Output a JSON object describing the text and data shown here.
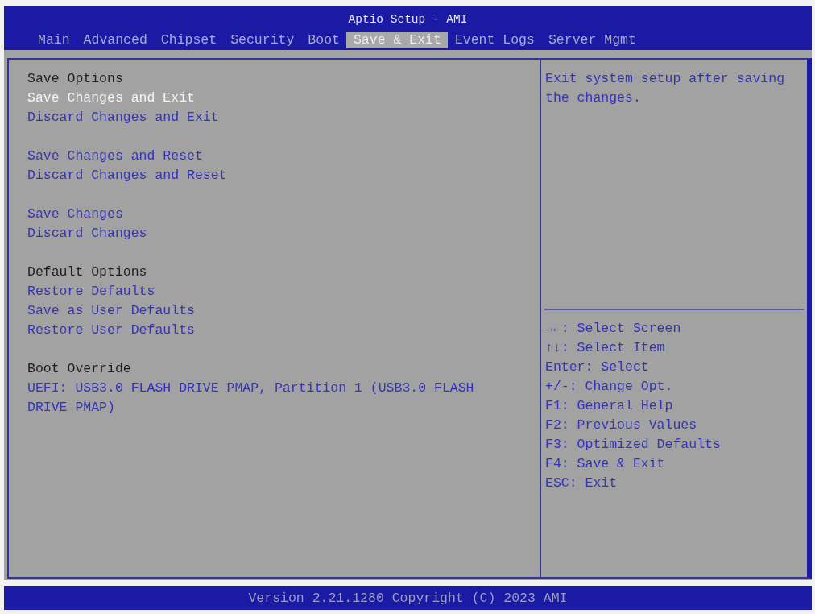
{
  "window": {
    "title": "Aptio Setup - AMI"
  },
  "tabs": [
    {
      "label": "Main",
      "selected": false
    },
    {
      "label": "Advanced",
      "selected": false
    },
    {
      "label": "Chipset",
      "selected": false
    },
    {
      "label": "Security",
      "selected": false
    },
    {
      "label": "Boot",
      "selected": false
    },
    {
      "label": "Save & Exit",
      "selected": true
    },
    {
      "label": "Event Logs",
      "selected": false
    },
    {
      "label": "Server Mgmt",
      "selected": false
    }
  ],
  "menu": {
    "sections": [
      {
        "heading": "Save Options",
        "items": [
          {
            "label": "Save Changes and Exit",
            "selected": true
          },
          {
            "label": "Discard Changes and Exit",
            "selected": false
          }
        ]
      },
      {
        "items": [
          {
            "label": "Save Changes and Reset",
            "selected": false
          },
          {
            "label": "Discard Changes and Reset",
            "selected": false
          }
        ]
      },
      {
        "items": [
          {
            "label": "Save Changes",
            "selected": false
          },
          {
            "label": "Discard Changes",
            "selected": false
          }
        ]
      },
      {
        "heading": "Default Options",
        "items": [
          {
            "label": "Restore Defaults",
            "selected": false
          },
          {
            "label": "Save as User Defaults",
            "selected": false
          },
          {
            "label": "Restore User Defaults",
            "selected": false
          }
        ]
      },
      {
        "heading": "Boot Override",
        "items": [
          {
            "label": "UEFI: USB3.0 FLASH DRIVE PMAP, Partition 1 (USB3.0 FLASH DRIVE PMAP)",
            "selected": false
          }
        ]
      }
    ]
  },
  "help": {
    "text": "Exit system setup after saving the changes."
  },
  "key_hints": [
    "→←: Select Screen",
    "↑↓: Select Item",
    "Enter: Select",
    "+/-: Change Opt.",
    "F1: General Help",
    "F2: Previous Values",
    "F3: Optimized Defaults",
    "F4: Save & Exit",
    "ESC: Exit"
  ],
  "footer": {
    "text": "Version 2.21.1280 Copyright (C) 2023 AMI"
  }
}
